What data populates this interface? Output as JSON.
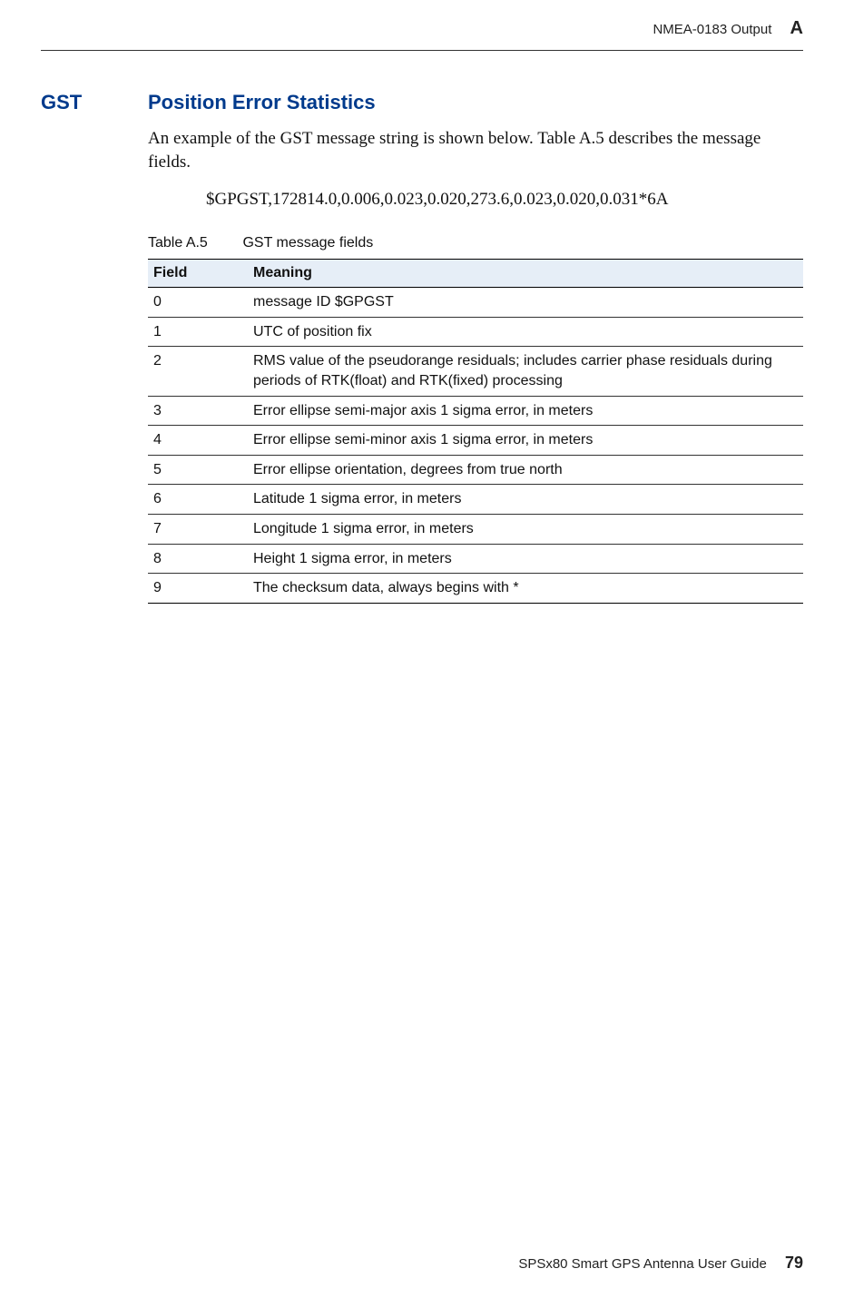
{
  "header": {
    "section_name": "NMEA-0183 Output",
    "appendix_letter": "A"
  },
  "section": {
    "tag": "GST",
    "title": "Position Error Statistics",
    "intro": "An example of the GST message string is shown below. Table A.5 describes the message fields.",
    "example": "$GPGST,172814.0,0.006,0.023,0.020,273.6,0.023,0.020,0.031*6A"
  },
  "table": {
    "label": "Table A.5",
    "caption": "GST message fields",
    "headers": {
      "field": "Field",
      "meaning": "Meaning"
    },
    "rows": [
      {
        "field": "0",
        "meaning": "message ID $GPGST"
      },
      {
        "field": "1",
        "meaning": "UTC of position fix"
      },
      {
        "field": "2",
        "meaning": "RMS value of the pseudorange residuals; includes carrier phase residuals during periods of RTK(float) and RTK(fixed) processing"
      },
      {
        "field": "3",
        "meaning": "Error ellipse semi-major axis 1 sigma error, in meters"
      },
      {
        "field": "4",
        "meaning": "Error ellipse semi-minor axis 1 sigma error, in meters"
      },
      {
        "field": "5",
        "meaning": "Error ellipse orientation, degrees from true north"
      },
      {
        "field": "6",
        "meaning": "Latitude 1 sigma error, in meters"
      },
      {
        "field": "7",
        "meaning": "Longitude 1 sigma error, in meters"
      },
      {
        "field": "8",
        "meaning": "Height 1 sigma error, in meters"
      },
      {
        "field": "9",
        "meaning": "The checksum data, always begins with *"
      }
    ]
  },
  "footer": {
    "guide": "SPSx80 Smart GPS Antenna User Guide",
    "page": "79"
  }
}
